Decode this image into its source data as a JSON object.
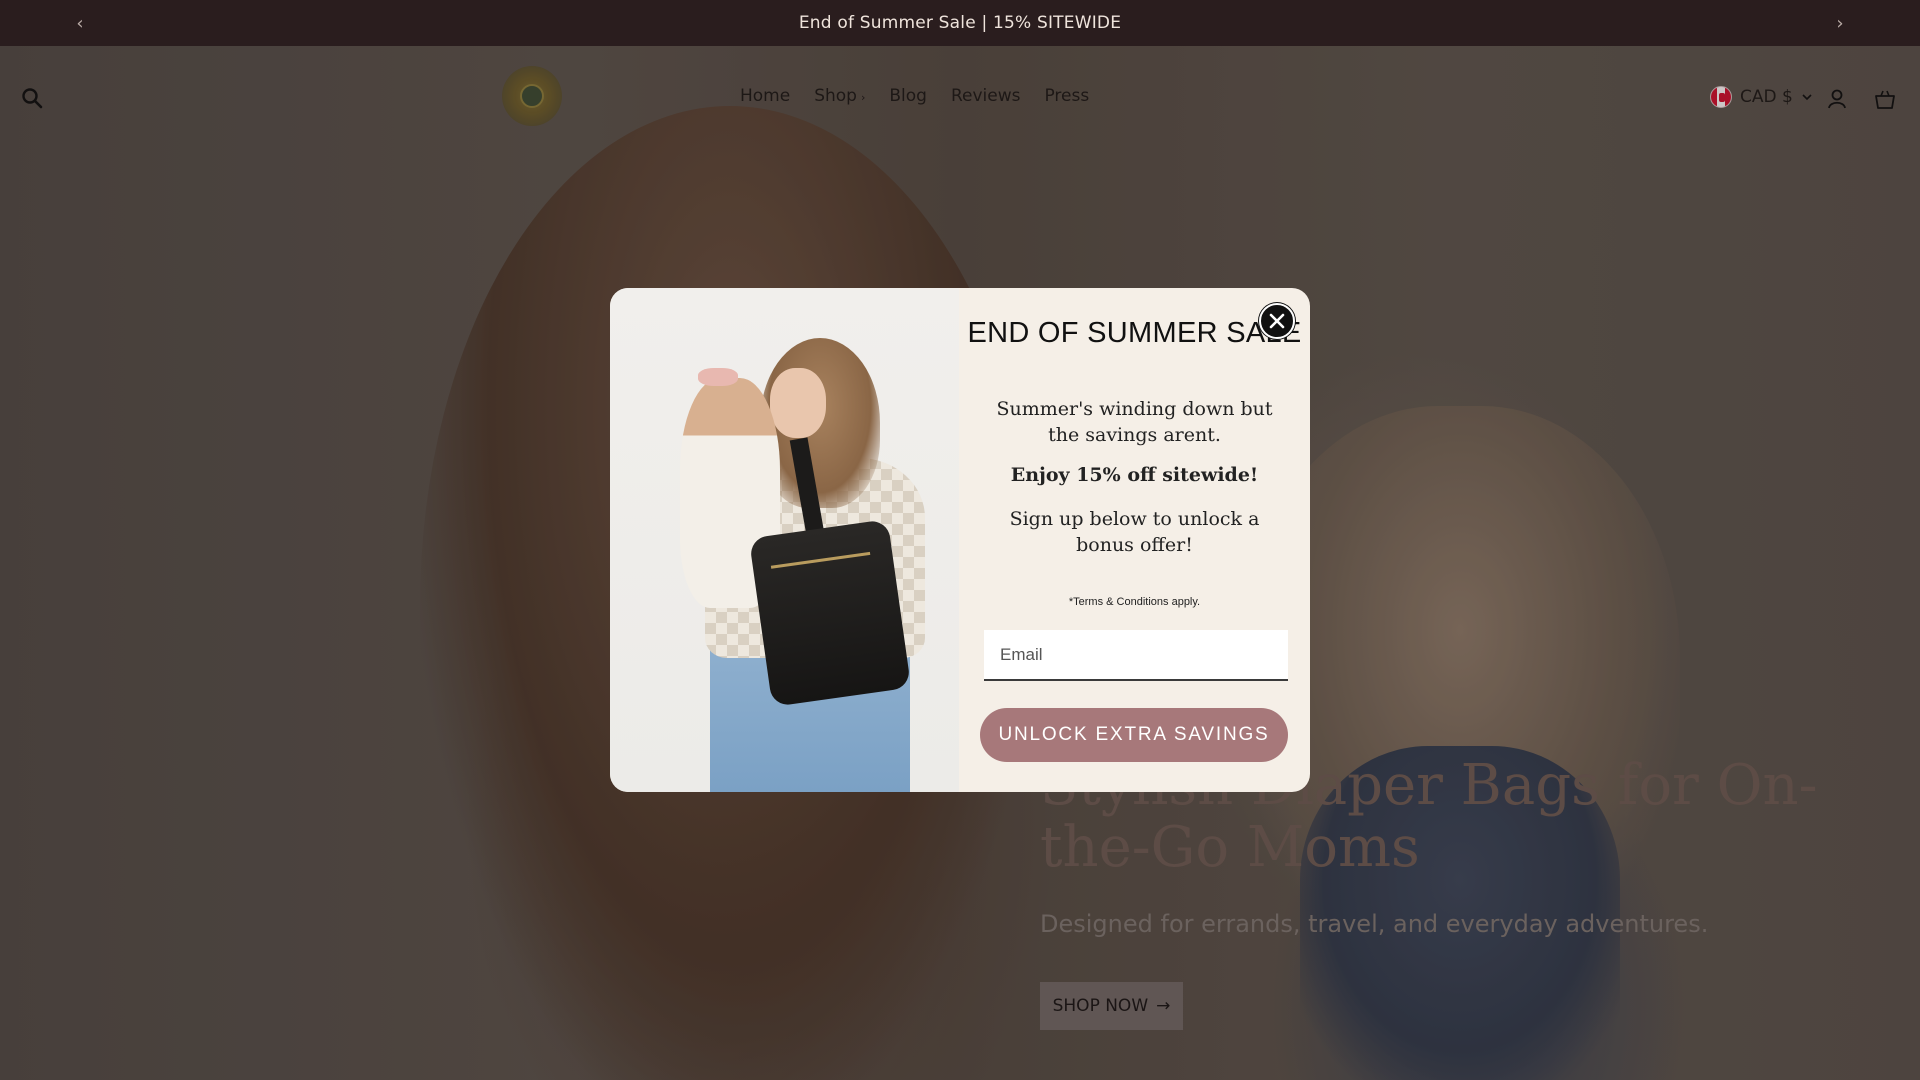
{
  "announcement": {
    "message": "End of Summer Sale | 15% SITEWIDE",
    "prev_icon": "‹",
    "next_icon": "›"
  },
  "header": {
    "nav": [
      {
        "label": "Home"
      },
      {
        "label": "Shop"
      },
      {
        "label": "Blog"
      },
      {
        "label": "Reviews"
      },
      {
        "label": "Press"
      }
    ],
    "shop_chevron": "›",
    "currency": {
      "label": "CAD $",
      "flag": "canada-flag-icon"
    },
    "icons": [
      "search-icon",
      "account-icon",
      "cart-icon"
    ]
  },
  "hero": {
    "title": "Stylish Diaper Bags for On- the-Go Moms",
    "subtitle": "Designed for errands, travel, and everyday adventures.",
    "cta_label": "SHOP NOW",
    "cta_arrow": "→"
  },
  "popup": {
    "title": "END OF SUMMER SALE",
    "subtitle": "Summer's winding down but the savings arent.",
    "offer": "Enjoy 15% off sitewide!",
    "signup_text": "Sign up below to unlock a bonus offer!",
    "terms": "*Terms & Conditions apply.",
    "email_placeholder": "Email",
    "button_label": "UNLOCK EXTRA SAVINGS",
    "colors": {
      "button": "#a7787a",
      "background": "#f5efe7"
    }
  }
}
